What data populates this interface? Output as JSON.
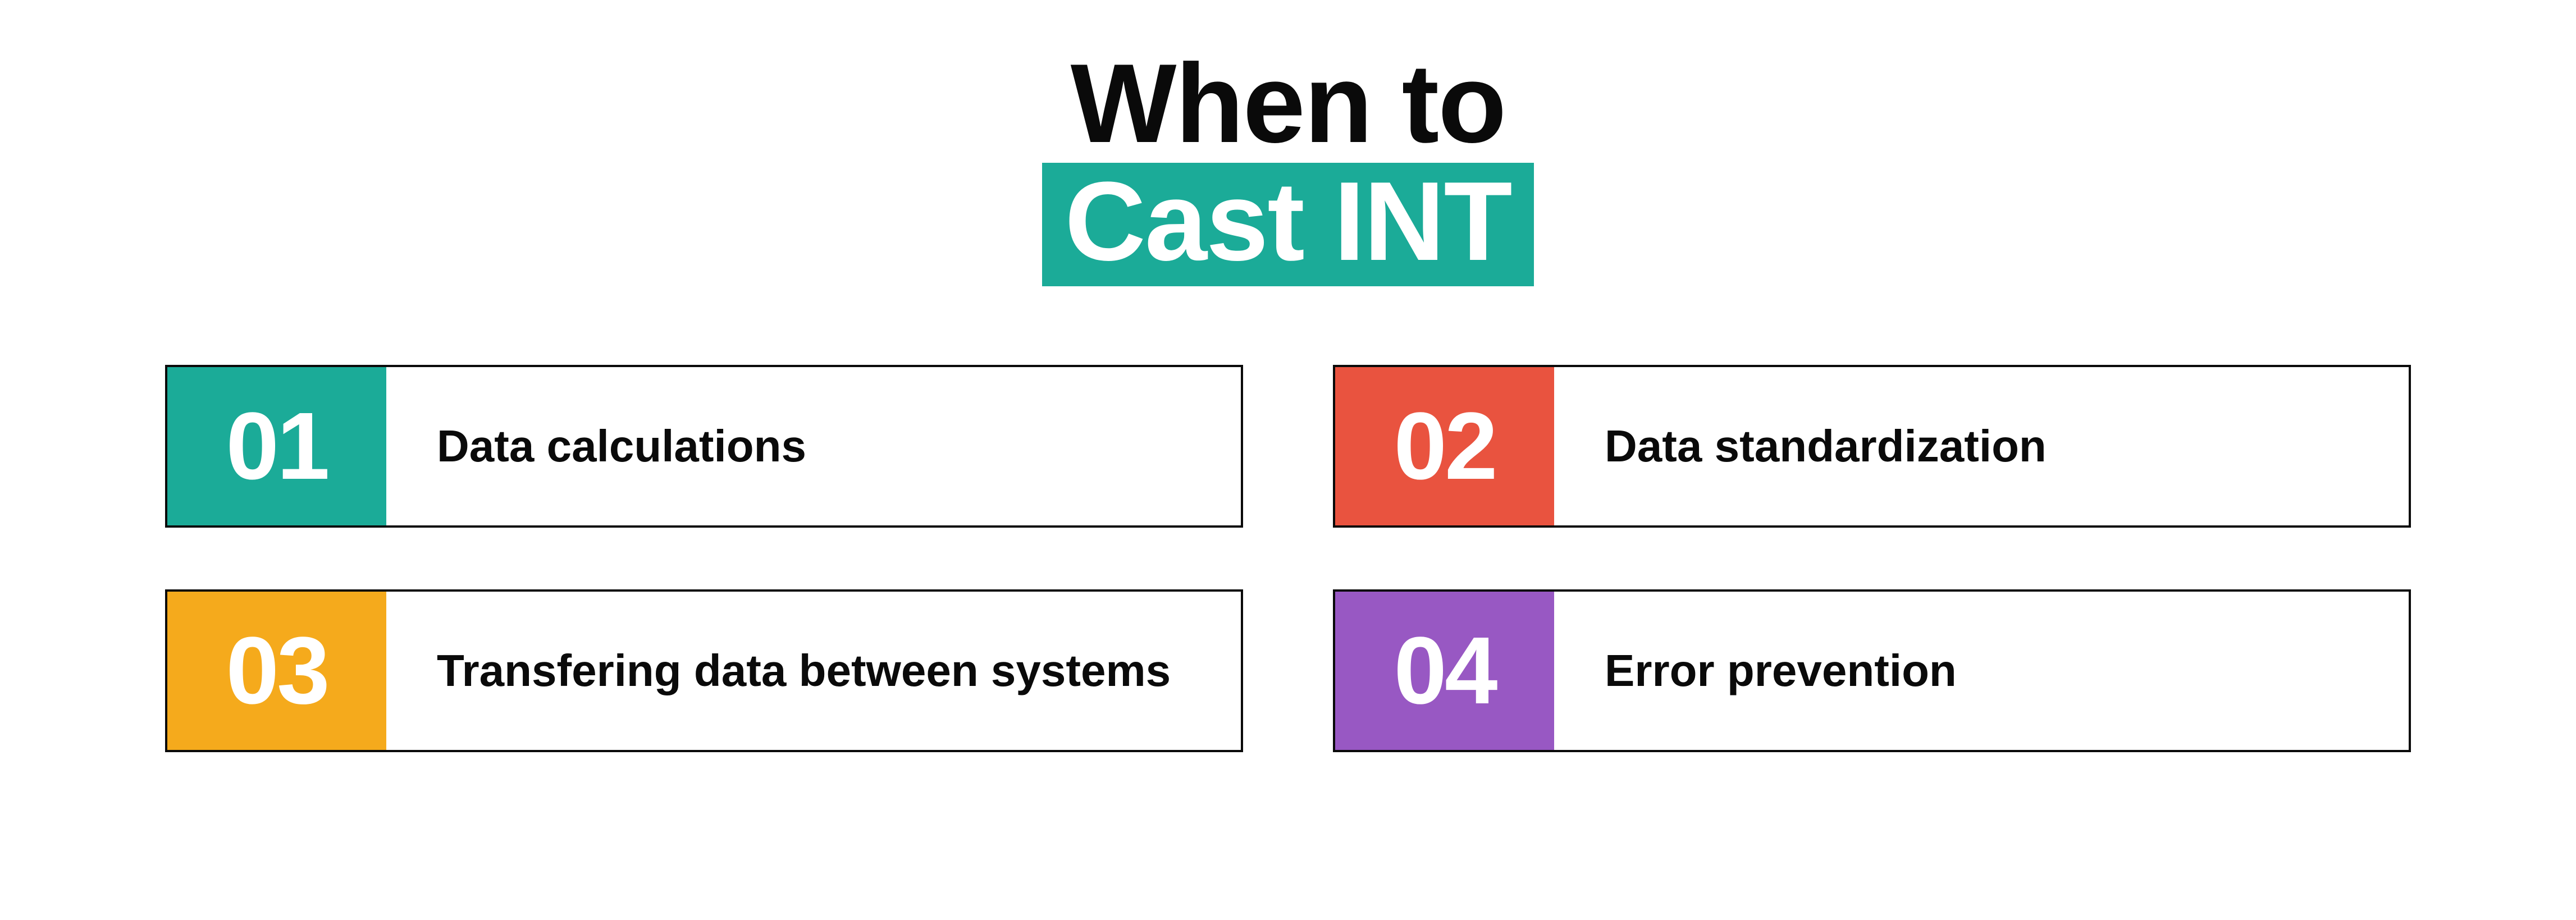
{
  "title": {
    "line1": "When to",
    "line2": "Cast INT"
  },
  "colors": {
    "teal": "#1bab98",
    "red": "#e9533f",
    "yellow": "#f5aa1c",
    "purple": "#9858c3"
  },
  "items": [
    {
      "num": "01",
      "label": "Data calculations",
      "color": "teal"
    },
    {
      "num": "02",
      "label": "Data standardization",
      "color": "red"
    },
    {
      "num": "03",
      "label": "Transfering data between systems",
      "color": "yellow"
    },
    {
      "num": "04",
      "label": "Error prevention",
      "color": "purple"
    }
  ]
}
